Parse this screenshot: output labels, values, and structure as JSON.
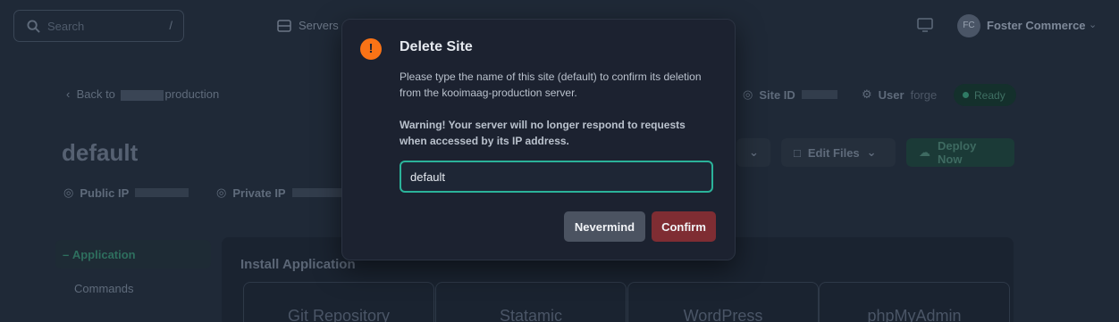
{
  "topbar": {
    "search_placeholder": "Search",
    "search_shortcut": "/",
    "servers_label": "Servers",
    "avatar_initials": "FC",
    "account_name": "Foster Commerce"
  },
  "site": {
    "back_prefix": "Back to",
    "back_suffix": "production",
    "title": "default",
    "public_ip_label": "Public IP",
    "private_ip_label": "Private IP",
    "site_id_label": "Site ID",
    "user_label": "User",
    "user_value": "forge",
    "status": "Ready",
    "edit_files_label": "Edit Files",
    "deploy_now_label": "Deploy Now"
  },
  "sidebar": {
    "active_label": "Application",
    "items": [
      "Commands"
    ]
  },
  "install": {
    "title": "Install Application",
    "cards": [
      "Git Repository",
      "Statamic",
      "WordPress",
      "phpMyAdmin"
    ]
  },
  "modal": {
    "title": "Delete Site",
    "icon": "exclamation-icon",
    "description": "Please type the name of this site (default) to confirm its deletion from the kooimaag-production server.",
    "warning": "Warning! Your server will no longer respond to requests when accessed by its IP address.",
    "input_value": "default",
    "nevermind_label": "Nevermind",
    "confirm_label": "Confirm"
  },
  "colors": {
    "accent": "#2bb39a",
    "danger": "#7f2d33",
    "warning": "#f97316"
  }
}
